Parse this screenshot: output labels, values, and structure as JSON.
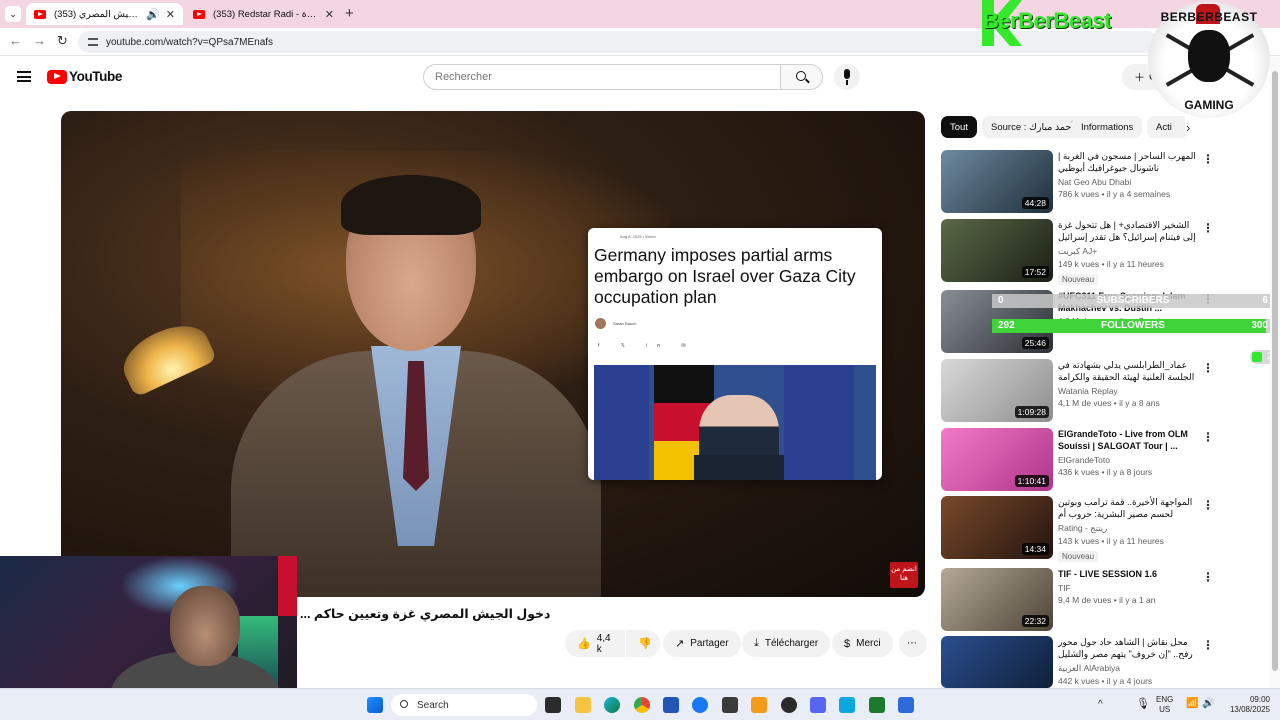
{
  "browser": {
    "tabs": [
      {
        "title": "(353) دخول الجيش المصري ...",
        "active": true,
        "audio": true
      },
      {
        "title": "(353) Redstar Radi - الشفقرة - YouTube",
        "active": false
      }
    ],
    "url": "youtube.com/watch?v=QPsa7MEnafs"
  },
  "header": {
    "logo_text": "YouTube",
    "search_placeholder": "Rechercher",
    "create_label": "Cr"
  },
  "player": {
    "article": {
      "date": "Aug 8, 2025 • World",
      "headline": "Germany imposes partial arms embargo on Israel over Gaza City occupation plan",
      "author": "Sarah Rauch"
    },
    "corner_badge": "انضم من هنا"
  },
  "video": {
    "title": "دخول الجيش المصري غزة وتعيين حاكم ...",
    "likes": "4,4 k",
    "share_label": "Partager",
    "download_label": "Télécharger",
    "thanks_label": "Merci"
  },
  "chips": [
    {
      "label": "Tout",
      "active": true
    },
    {
      "label": "Source : أحمد مبارك",
      "active": false
    },
    {
      "label": "Informations",
      "active": false
    },
    {
      "label": "Acti",
      "active": false
    }
  ],
  "recommendations": [
    {
      "title": "المهرب الساحر | مسجون في الغربة | ناشونال جيوغرافيك أبوظبي",
      "rtl": true,
      "channel": "Nat Geo Abu Dhabi",
      "stats": "786 k vues • il y a 4 semaines",
      "duration": "44:28",
      "badge": ""
    },
    {
      "title": "الشخير الاقتصادي+ | هل تتحول غزة إلى فيتنام إسرائيل؟ هل تقدر إسرائيل على تكلفة ...",
      "rtl": true,
      "channel": "كبريت AJ+",
      "stats": "149 k vues • il y a 11 heures",
      "duration": "17:52",
      "badge": "Nouveau"
    },
    {
      "title": "#UFC311 Free Sparring: Islam Makhachev vs. Dustin ...",
      "rtl": false,
      "channel": "",
      "stats": "4,3 M de vues • il y a 7 mois",
      "duration": "25:46",
      "badge": ""
    },
    {
      "title": "عماد_الطرابلسي يدلي بشهادته في الجلسة العلنية لهيئة الحقيقة والكرامة",
      "rtl": true,
      "channel": "Watania Replay",
      "stats": "4,1 M de vues • il y a 8 ans",
      "duration": "1:09:28",
      "badge": ""
    },
    {
      "title": "ElGrandeToto - Live from OLM Souissi | SALGOAT Tour | ...",
      "rtl": false,
      "channel": "ElGrandeToto",
      "stats": "436 k vues • il y a 8 jours",
      "duration": "1:10:41",
      "badge": ""
    },
    {
      "title": "المواجهة الأخيرة.. قمة ترامب وبوتين لحسم مصير البشرية: حروب أم سلام؟",
      "rtl": true,
      "channel": "Rating - ريتنج",
      "stats": "143 k vues • il y a 11 heures",
      "duration": "14:34",
      "badge": "Nouveau"
    },
    {
      "title": "TIF - LIVE SESSION 1.6",
      "rtl": false,
      "channel": "TIF",
      "stats": "9,4 M de vues • il y a 1 an",
      "duration": "22:32",
      "badge": ""
    },
    {
      "title": "محل نقاش | الشاهد حاد حول محور رفح.. \"إن خروف\" يتهم مصر والشليل يرد",
      "rtl": true,
      "channel": "العربية AlArabiya",
      "stats": "442 k vues • il y a 4 jours",
      "duration": "",
      "badge": ""
    }
  ],
  "overlay": {
    "brand": "BerBerBeast",
    "logo_top": "BERBERBEAST",
    "logo_bottom": "GAMING",
    "subscribers_label": "SUBSCRIBERS",
    "subscribers_current": "0",
    "subscribers_goal": "6",
    "followers_label": "FOLLOWERS",
    "followers_current": "292",
    "followers_goal": "300",
    "followers_progress": 0.97,
    "toggle_count": "2"
  },
  "taskbar": {
    "search_placeholder": "Search",
    "lang": "ENG",
    "region": "US",
    "time": "09:00",
    "date": "13/08/2025"
  }
}
